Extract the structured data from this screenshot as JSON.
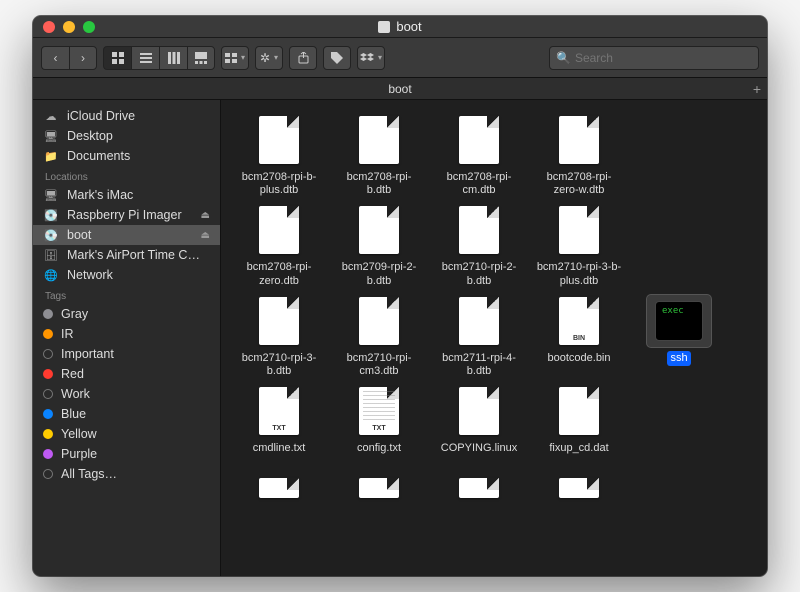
{
  "window": {
    "title": "boot"
  },
  "toolbar": {
    "search_placeholder": "Search"
  },
  "pathbar": {
    "current": "boot"
  },
  "sidebar": {
    "favorites": [
      {
        "icon": "cloud",
        "label": "iCloud Drive"
      },
      {
        "icon": "desktop",
        "label": "Desktop"
      },
      {
        "icon": "folder",
        "label": "Documents"
      }
    ],
    "locations_header": "Locations",
    "locations": [
      {
        "icon": "imac",
        "label": "Mark's iMac",
        "eject": false
      },
      {
        "icon": "disk",
        "label": "Raspberry Pi Imager",
        "eject": true
      },
      {
        "icon": "disk",
        "label": "boot",
        "eject": true,
        "selected": true
      },
      {
        "icon": "timecapsule",
        "label": "Mark's AirPort Time C…",
        "eject": false
      },
      {
        "icon": "globe",
        "label": "Network",
        "eject": false
      }
    ],
    "tags_header": "Tags",
    "tags": [
      {
        "color": "#8e8e93",
        "label": "Gray"
      },
      {
        "color": "#ff9500",
        "label": "IR"
      },
      {
        "color": "none",
        "label": "Important"
      },
      {
        "color": "#ff3b30",
        "label": "Red"
      },
      {
        "color": "none",
        "label": "Work"
      },
      {
        "color": "#0a84ff",
        "label": "Blue"
      },
      {
        "color": "#ffcc00",
        "label": "Yellow"
      },
      {
        "color": "#bf5af2",
        "label": "Purple"
      },
      {
        "color": "none",
        "label": "All Tags…"
      }
    ]
  },
  "files": [
    {
      "name": "bcm2708-rpi-b-plus.dtb",
      "badge": ""
    },
    {
      "name": "bcm2708-rpi-b.dtb",
      "badge": ""
    },
    {
      "name": "bcm2708-rpi-cm.dtb",
      "badge": ""
    },
    {
      "name": "bcm2708-rpi-zero-w.dtb",
      "badge": ""
    },
    {
      "name": "",
      "badge": "",
      "placeholder": true
    },
    {
      "name": "bcm2708-rpi-zero.dtb",
      "badge": ""
    },
    {
      "name": "bcm2709-rpi-2-b.dtb",
      "badge": ""
    },
    {
      "name": "bcm2710-rpi-2-b.dtb",
      "badge": ""
    },
    {
      "name": "bcm2710-rpi-3-b-plus.dtb",
      "badge": ""
    },
    {
      "name": "",
      "badge": "",
      "placeholder": true
    },
    {
      "name": "bcm2710-rpi-3-b.dtb",
      "badge": ""
    },
    {
      "name": "bcm2710-rpi-cm3.dtb",
      "badge": ""
    },
    {
      "name": "bcm2711-rpi-4-b.dtb",
      "badge": ""
    },
    {
      "name": "bootcode.bin",
      "badge": "BIN"
    },
    {
      "name": "ssh",
      "badge": "",
      "exec": true,
      "selected": true
    },
    {
      "name": "cmdline.txt",
      "badge": "TXT"
    },
    {
      "name": "config.txt",
      "badge": "TXT",
      "lines": true
    },
    {
      "name": "COPYING.linux",
      "badge": ""
    },
    {
      "name": "fixup_cd.dat",
      "badge": ""
    },
    {
      "name": "",
      "badge": "",
      "placeholder": true
    },
    {
      "name": "",
      "badge": "",
      "partial": true
    },
    {
      "name": "",
      "badge": "",
      "partial": true
    },
    {
      "name": "",
      "badge": "",
      "partial": true
    },
    {
      "name": "",
      "badge": "",
      "partial": true
    }
  ]
}
